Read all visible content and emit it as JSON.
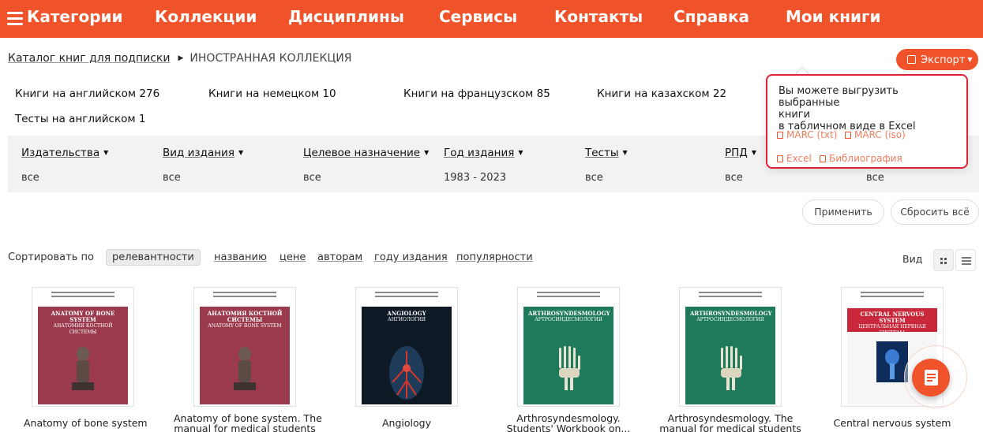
{
  "nav": {
    "items": [
      "Категории",
      "Коллекции",
      "Дисциплины",
      "Сервисы",
      "Контакты",
      "Справка",
      "Мои книги"
    ]
  },
  "breadcrumb": {
    "catalog": "Каталог книг для подписки",
    "current": "ИНОСТРАННАЯ КОЛЛЕКЦИЯ"
  },
  "export": {
    "label": "Экспорт",
    "popup_text": [
      "Вы можете выгрузить выбранные",
      "книги",
      "в табличном виде в Excel"
    ],
    "links": [
      "MARC (txt)",
      "MARC (iso)",
      "Excel",
      "Библиография"
    ]
  },
  "languages": [
    "Книги на английском 276",
    "Книги на немецком 10",
    "Книги на французском 85",
    "Книги на казахском 22",
    "Тесты на английском 1"
  ],
  "filters": [
    {
      "label": "Издательства",
      "value": "все"
    },
    {
      "label": "Вид издания",
      "value": "все"
    },
    {
      "label": "Целевое назначение",
      "value": "все"
    },
    {
      "label": "Год издания",
      "value": "1983 - 2023"
    },
    {
      "label": "Тесты",
      "value": "все"
    },
    {
      "label": "РПД",
      "value": "все"
    },
    {
      "label": "",
      "value": "все"
    }
  ],
  "buttons": {
    "apply": "Применить",
    "reset": "Сбросить всё"
  },
  "sort": {
    "label": "Сортировать по",
    "options": [
      "релевантности",
      "названию",
      "цене",
      "авторам",
      "году издания",
      "популярности"
    ],
    "active": "релевантности"
  },
  "view": {
    "label": "Вид"
  },
  "books": [
    {
      "title_lines": [
        "Anatomy of bone system"
      ],
      "cover_color": "#9a3a4c",
      "cover_title": "ANATOMY OF BONE SYSTEM",
      "cover_sub": "АНАТОМИЯ КОСТНОЙ СИСТЕМЫ"
    },
    {
      "title_lines": [
        "Anatomy of bone system. The",
        "manual for medical students"
      ],
      "cover_color": "#9a3a4c",
      "cover_title": "АНАТОМИЯ КОСТНОЙ СИСТЕМЫ",
      "cover_sub": "ANATOMY OF BONE SYSTEM"
    },
    {
      "title_lines": [
        "Angiology"
      ],
      "cover_color": "#0d1a26",
      "cover_title": "ANGIOLOGY",
      "cover_sub": "АНГИОЛОГИЯ"
    },
    {
      "title_lines": [
        "Arthrosyndesmology.",
        "Students' Workbook on..."
      ],
      "cover_color": "#1e7a5a",
      "cover_title": "ARTHROSYNDESMOLOGY",
      "cover_sub": "АРТРОСИНДЕСМОЛОГИЯ"
    },
    {
      "title_lines": [
        "Arthrosyndesmology. The",
        "manual for medical students"
      ],
      "cover_color": "#1e7a5a",
      "cover_title": "ARTHROSYNDESMOLOGY",
      "cover_sub": "АРТРОСИНДЕСМОЛОГИЯ"
    },
    {
      "title_lines": [
        "Central nervous system"
      ],
      "cover_color": "#c8283a",
      "cover_title": "CENTRAL NERVOUS SYSTEM",
      "cover_sub": "ЦЕНТРАЛЬНАЯ НЕРВНАЯ СИСТЕМА"
    }
  ],
  "colors": {
    "brand": "#f0532a",
    "popup_border": "#e2203a"
  }
}
